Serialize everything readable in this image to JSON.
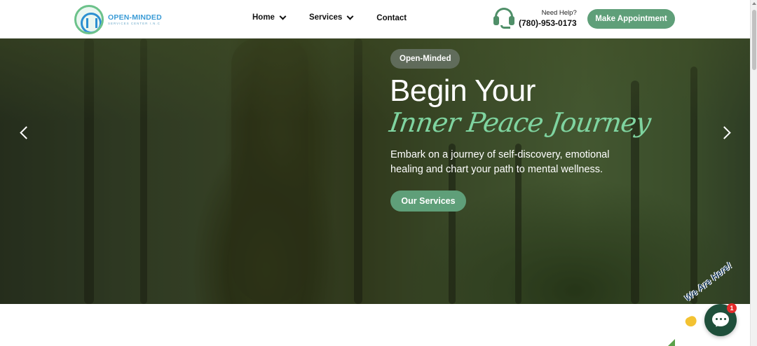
{
  "header": {
    "logo": {
      "name": "OPEN-MINDED",
      "subtitle": "SERVICES CENTER I.N.C"
    },
    "nav": [
      {
        "label": "Home",
        "has_dropdown": true
      },
      {
        "label": "Services",
        "has_dropdown": true
      },
      {
        "label": "Contact",
        "has_dropdown": false
      }
    ],
    "help": {
      "label": "Need Help?",
      "phone": "(780)-953-0173",
      "icon": "headset-icon"
    },
    "appointment_button": "Make Appointment"
  },
  "hero": {
    "badge": "Open-Minded",
    "title": "Begin Your",
    "script_title": "Inner Peace Journey",
    "description": "Embark on a journey of self-discovery, emotional healing and chart your path to mental wellness.",
    "cta_button": "Our Services",
    "prev_icon": "chevron-left-icon",
    "next_icon": "chevron-right-icon"
  },
  "chat": {
    "tagline": "We Are Here!",
    "unread_count": "1",
    "icon": "chat-bubble-icon"
  },
  "colors": {
    "accent": "#5f9f79",
    "script_accent": "#7fd4a0",
    "chat_bg": "#1f4f3a",
    "badge_red": "#e52b2b"
  }
}
